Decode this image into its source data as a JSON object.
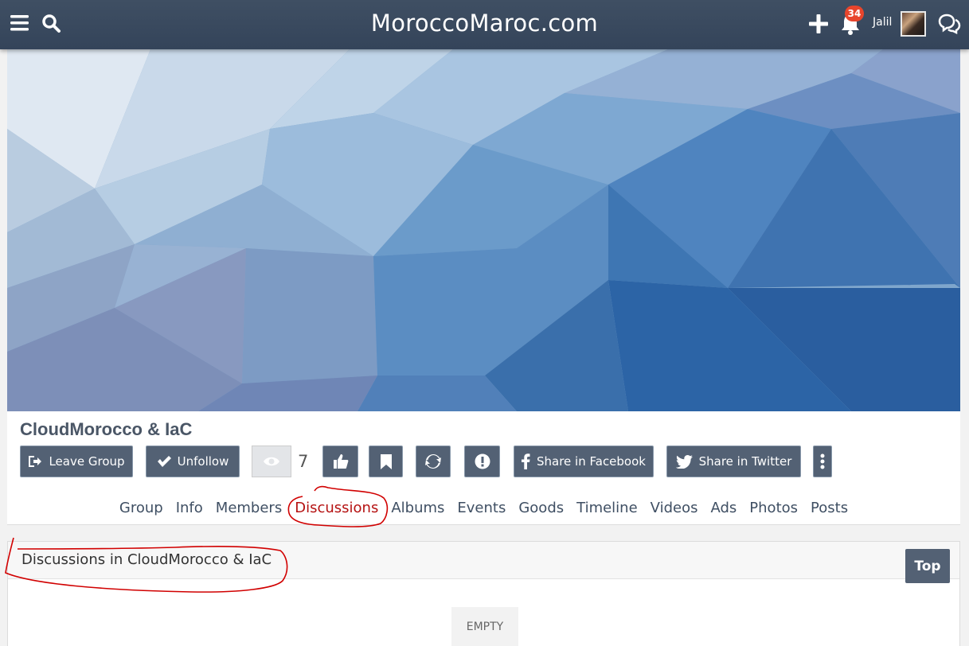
{
  "site": {
    "title": "MoroccoMaroc.com"
  },
  "navbar": {
    "notification_count": "34",
    "user_name": "Jalil",
    "icons": [
      "menu-icon",
      "search-icon",
      "plus-icon",
      "bell-icon",
      "chat-icon"
    ]
  },
  "group": {
    "title": "CloudMorocco & IaC",
    "view_count": "7",
    "buttons": {
      "leave": "Leave Group",
      "unfollow": "Unfollow",
      "share_facebook": "Share in Facebook",
      "share_twitter": "Share in Twitter"
    }
  },
  "tabs": [
    "Group",
    "Info",
    "Members",
    "Discussions",
    "Albums",
    "Events",
    "Goods",
    "Timeline",
    "Videos",
    "Ads",
    "Photos",
    "Posts"
  ],
  "active_tab": "Discussions",
  "discussions": {
    "heading": "Discussions in CloudMorocco & IaC",
    "empty_text": "EMPTY"
  },
  "top_button": "Top",
  "colors": {
    "navbar": "#3b4b60",
    "button": "#536174",
    "active_tab": "#b51212",
    "badge": "#e8452c",
    "annotation": "#d10000"
  }
}
